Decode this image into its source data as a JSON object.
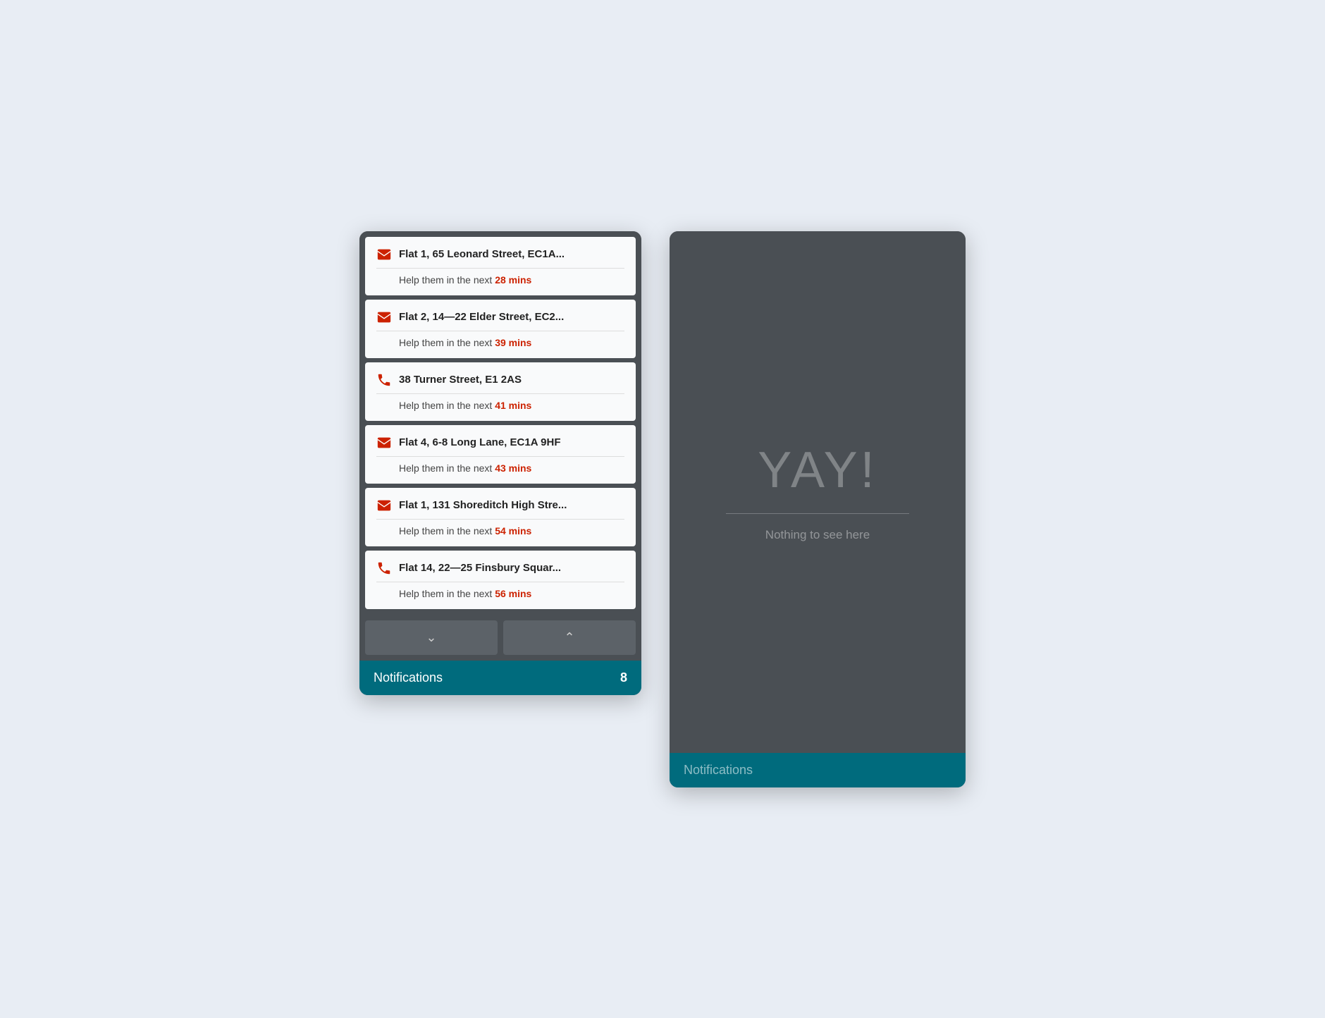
{
  "phones": {
    "left": {
      "notifications": [
        {
          "id": 1,
          "icon": "mail",
          "title": "Flat 1, 65 Leonard Street, EC1A...",
          "subtitle_prefix": "Help them in the next ",
          "time": "28 mins"
        },
        {
          "id": 2,
          "icon": "mail",
          "title": "Flat 2, 14—22 Elder Street, EC2...",
          "subtitle_prefix": "Help them in the next ",
          "time": "39 mins"
        },
        {
          "id": 3,
          "icon": "phone",
          "title": "38 Turner Street, E1 2AS",
          "subtitle_prefix": "Help them in the next ",
          "time": "41 mins"
        },
        {
          "id": 4,
          "icon": "mail",
          "title": "Flat 4, 6-8 Long Lane, EC1A 9HF",
          "subtitle_prefix": "Help them in the next ",
          "time": "43 mins"
        },
        {
          "id": 5,
          "icon": "mail",
          "title": "Flat 1, 131 Shoreditch High Stre...",
          "subtitle_prefix": "Help them in the next ",
          "time": "54 mins"
        },
        {
          "id": 6,
          "icon": "phone",
          "title": "Flat 14, 22—25 Finsbury Squar...",
          "subtitle_prefix": "Help them in the next ",
          "time": "56 mins"
        }
      ],
      "tab_label": "Notifications",
      "tab_badge": "8",
      "nav_down": "▾",
      "nav_up": "▴"
    },
    "right": {
      "empty_title": "YAY!",
      "empty_subtitle": "Nothing to see here",
      "tab_label": "Notifications"
    }
  }
}
